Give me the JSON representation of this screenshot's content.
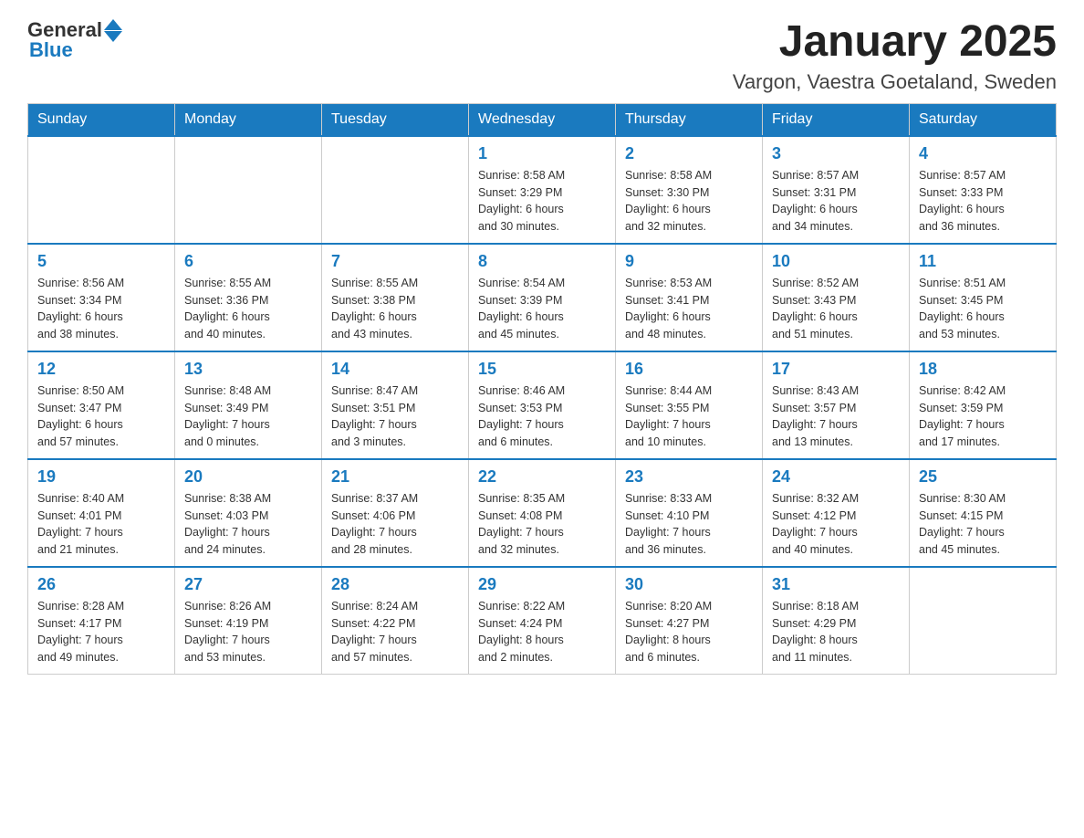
{
  "header": {
    "logo_general": "General",
    "logo_blue": "Blue",
    "month_title": "January 2025",
    "location": "Vargon, Vaestra Goetaland, Sweden"
  },
  "days_of_week": [
    "Sunday",
    "Monday",
    "Tuesday",
    "Wednesday",
    "Thursday",
    "Friday",
    "Saturday"
  ],
  "weeks": [
    {
      "days": [
        {
          "number": "",
          "info": ""
        },
        {
          "number": "",
          "info": ""
        },
        {
          "number": "",
          "info": ""
        },
        {
          "number": "1",
          "info": "Sunrise: 8:58 AM\nSunset: 3:29 PM\nDaylight: 6 hours\nand 30 minutes."
        },
        {
          "number": "2",
          "info": "Sunrise: 8:58 AM\nSunset: 3:30 PM\nDaylight: 6 hours\nand 32 minutes."
        },
        {
          "number": "3",
          "info": "Sunrise: 8:57 AM\nSunset: 3:31 PM\nDaylight: 6 hours\nand 34 minutes."
        },
        {
          "number": "4",
          "info": "Sunrise: 8:57 AM\nSunset: 3:33 PM\nDaylight: 6 hours\nand 36 minutes."
        }
      ]
    },
    {
      "days": [
        {
          "number": "5",
          "info": "Sunrise: 8:56 AM\nSunset: 3:34 PM\nDaylight: 6 hours\nand 38 minutes."
        },
        {
          "number": "6",
          "info": "Sunrise: 8:55 AM\nSunset: 3:36 PM\nDaylight: 6 hours\nand 40 minutes."
        },
        {
          "number": "7",
          "info": "Sunrise: 8:55 AM\nSunset: 3:38 PM\nDaylight: 6 hours\nand 43 minutes."
        },
        {
          "number": "8",
          "info": "Sunrise: 8:54 AM\nSunset: 3:39 PM\nDaylight: 6 hours\nand 45 minutes."
        },
        {
          "number": "9",
          "info": "Sunrise: 8:53 AM\nSunset: 3:41 PM\nDaylight: 6 hours\nand 48 minutes."
        },
        {
          "number": "10",
          "info": "Sunrise: 8:52 AM\nSunset: 3:43 PM\nDaylight: 6 hours\nand 51 minutes."
        },
        {
          "number": "11",
          "info": "Sunrise: 8:51 AM\nSunset: 3:45 PM\nDaylight: 6 hours\nand 53 minutes."
        }
      ]
    },
    {
      "days": [
        {
          "number": "12",
          "info": "Sunrise: 8:50 AM\nSunset: 3:47 PM\nDaylight: 6 hours\nand 57 minutes."
        },
        {
          "number": "13",
          "info": "Sunrise: 8:48 AM\nSunset: 3:49 PM\nDaylight: 7 hours\nand 0 minutes."
        },
        {
          "number": "14",
          "info": "Sunrise: 8:47 AM\nSunset: 3:51 PM\nDaylight: 7 hours\nand 3 minutes."
        },
        {
          "number": "15",
          "info": "Sunrise: 8:46 AM\nSunset: 3:53 PM\nDaylight: 7 hours\nand 6 minutes."
        },
        {
          "number": "16",
          "info": "Sunrise: 8:44 AM\nSunset: 3:55 PM\nDaylight: 7 hours\nand 10 minutes."
        },
        {
          "number": "17",
          "info": "Sunrise: 8:43 AM\nSunset: 3:57 PM\nDaylight: 7 hours\nand 13 minutes."
        },
        {
          "number": "18",
          "info": "Sunrise: 8:42 AM\nSunset: 3:59 PM\nDaylight: 7 hours\nand 17 minutes."
        }
      ]
    },
    {
      "days": [
        {
          "number": "19",
          "info": "Sunrise: 8:40 AM\nSunset: 4:01 PM\nDaylight: 7 hours\nand 21 minutes."
        },
        {
          "number": "20",
          "info": "Sunrise: 8:38 AM\nSunset: 4:03 PM\nDaylight: 7 hours\nand 24 minutes."
        },
        {
          "number": "21",
          "info": "Sunrise: 8:37 AM\nSunset: 4:06 PM\nDaylight: 7 hours\nand 28 minutes."
        },
        {
          "number": "22",
          "info": "Sunrise: 8:35 AM\nSunset: 4:08 PM\nDaylight: 7 hours\nand 32 minutes."
        },
        {
          "number": "23",
          "info": "Sunrise: 8:33 AM\nSunset: 4:10 PM\nDaylight: 7 hours\nand 36 minutes."
        },
        {
          "number": "24",
          "info": "Sunrise: 8:32 AM\nSunset: 4:12 PM\nDaylight: 7 hours\nand 40 minutes."
        },
        {
          "number": "25",
          "info": "Sunrise: 8:30 AM\nSunset: 4:15 PM\nDaylight: 7 hours\nand 45 minutes."
        }
      ]
    },
    {
      "days": [
        {
          "number": "26",
          "info": "Sunrise: 8:28 AM\nSunset: 4:17 PM\nDaylight: 7 hours\nand 49 minutes."
        },
        {
          "number": "27",
          "info": "Sunrise: 8:26 AM\nSunset: 4:19 PM\nDaylight: 7 hours\nand 53 minutes."
        },
        {
          "number": "28",
          "info": "Sunrise: 8:24 AM\nSunset: 4:22 PM\nDaylight: 7 hours\nand 57 minutes."
        },
        {
          "number": "29",
          "info": "Sunrise: 8:22 AM\nSunset: 4:24 PM\nDaylight: 8 hours\nand 2 minutes."
        },
        {
          "number": "30",
          "info": "Sunrise: 8:20 AM\nSunset: 4:27 PM\nDaylight: 8 hours\nand 6 minutes."
        },
        {
          "number": "31",
          "info": "Sunrise: 8:18 AM\nSunset: 4:29 PM\nDaylight: 8 hours\nand 11 minutes."
        },
        {
          "number": "",
          "info": ""
        }
      ]
    }
  ]
}
